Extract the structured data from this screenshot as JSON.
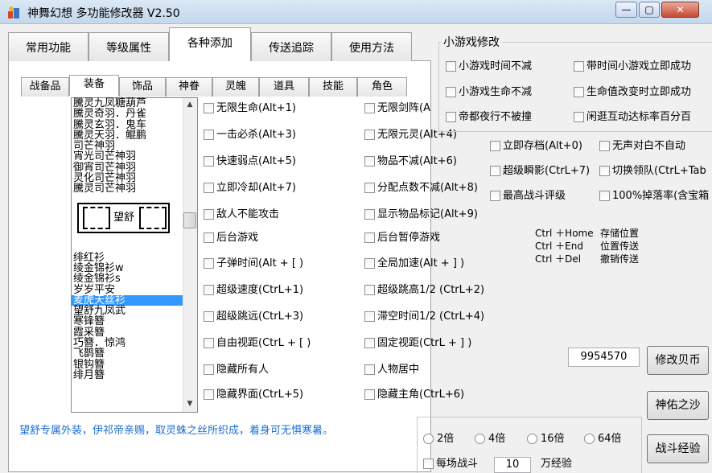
{
  "window": {
    "title": "神舞幻想 多功能修改器  V2.50",
    "controls": {
      "minimize": "—",
      "maximize": "▢",
      "close": "✕"
    }
  },
  "main_tabs": [
    "常用功能",
    "等级属性",
    "各种添加",
    "传送追踪",
    "使用方法"
  ],
  "sub_tabs": [
    "战备品",
    "装备",
    "饰品",
    "神眷",
    "灵魄",
    "道具",
    "技能",
    "角色"
  ],
  "list": {
    "items": [
      "騰灵九凤糖葫芦",
      "騰灵奇羽．丹雀",
      "騰灵玄羽．鬼车",
      "騰灵天羽．鲲鹏",
      "司芒神羽",
      "宵光司芒神羽",
      "御宵司芒神羽",
      "灵化司芒神羽",
      "騰灵司芒神羽"
    ],
    "boxed_item": "望舒",
    "items2": [
      "绯红衫",
      "绫金锦衫w",
      "绫金锦衫s",
      "岁岁平安",
      "麦虎天丝衫",
      "望舒九凤武",
      "寒锋簪",
      "霞采簪",
      "巧簪．惊鸿",
      "飞鹊簪",
      "银钩簪",
      "绯月簪"
    ],
    "selected_index": 4,
    "scroll_up": "▲",
    "scroll_down": "▼"
  },
  "description": "望舒专属外装，伊祁帝亲赐，取灵蛛之丝所织成，着身可无惧寒暑。",
  "options_col1": [
    "无限生命(Alt+1)",
    "一击必杀(Alt+3)",
    "快速弱点(Alt+5)",
    "立即冷却(Alt+7)",
    "敌人不能攻击",
    "后台游戏",
    "子弹时间(Alt + [ )",
    "超级速度(CtrL+1)",
    "超级跳远(CtrL+3)",
    "自由视距(CtrL + [ )",
    "隐藏所有人",
    "隐藏界面(CtrL+5)"
  ],
  "options_col2": [
    "无限剑阵(Al",
    "无限元灵(Alt+4)",
    "物品不减(Alt+6)",
    "分配点数不减(Alt+8)",
    "显示物品标记(Alt+9)",
    "后台暂停游戏",
    "全局加速(Alt + ] )",
    "超级跳高1/2 (CtrL+2)",
    "滞空时间1/2 (CtrL+4)",
    "固定视距(CtrL + ] )",
    "人物居中",
    "隐藏主角(CtrL+6)"
  ],
  "minigame": {
    "title": "小游戏修改",
    "options_left": [
      "小游戏时间不减",
      "小游戏生命不减",
      "帝都夜行不被撞"
    ],
    "options_right": [
      "带时间小游戏立即成功",
      "生命值改变时立即成功",
      "闲逛互动达标率百分百"
    ]
  },
  "extra_options": [
    [
      "立即存档(Alt+0)",
      "无声对白不自动"
    ],
    [
      "超级瞬影(CtrL+7)",
      "切换领队(CtrL+Tab"
    ],
    [
      "最高战斗评级",
      "100%掉落率(含宝箱"
    ]
  ],
  "hotkeys": [
    {
      "keys": "Ctrl ＋Home",
      "action": "存储位置"
    },
    {
      "keys": "Ctrl ＋End",
      "action": "位置传送"
    },
    {
      "keys": "Ctrl ＋Del",
      "action": "撤销传送"
    }
  ],
  "coins": {
    "value": "9954570",
    "button": "修改贝币"
  },
  "buttons": {
    "shenyou": "神佑之沙",
    "battle_exp": "战斗经验"
  },
  "multipliers": [
    "2倍",
    "4倍",
    "16倍",
    "64倍"
  ],
  "per_battle": {
    "label": "每场战斗",
    "value": "10",
    "unit": "万经验"
  },
  "colors": {
    "selection": "#3399ff",
    "description_text": "#1e6fd0"
  }
}
